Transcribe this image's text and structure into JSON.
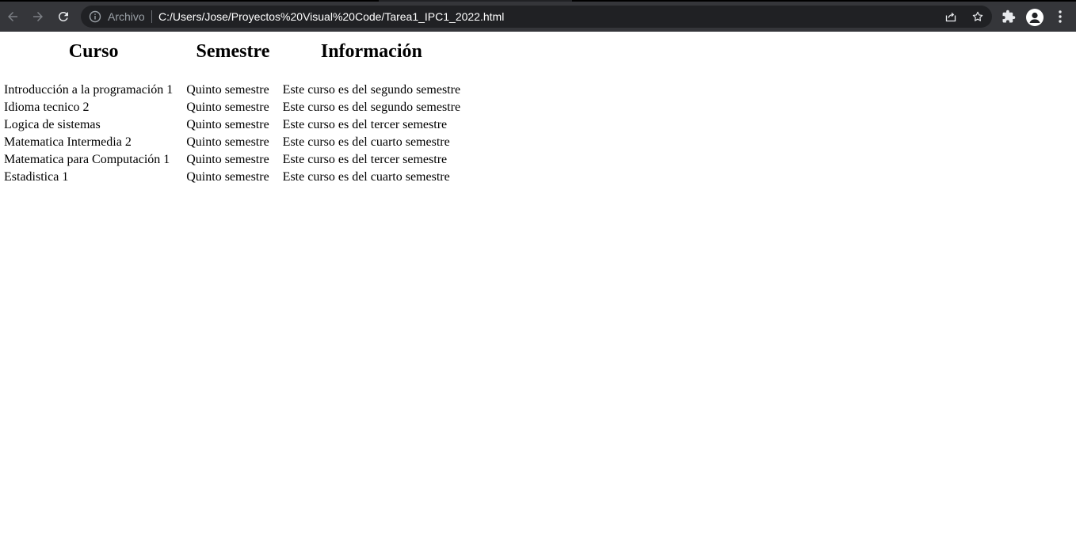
{
  "browser": {
    "scheme_label": "Archivo",
    "url": "C:/Users/Jose/Proyectos%20Visual%20Code/Tarea1_IPC1_2022.html",
    "icons": {
      "back": "arrow-left-icon",
      "forward": "arrow-right-icon",
      "reload": "reload-icon",
      "info": "info-icon",
      "share": "share-icon",
      "bookmark": "star-icon",
      "extensions": "puzzle-icon",
      "profile": "avatar-icon",
      "menu": "kebab-menu-icon"
    },
    "colors": {
      "toolbar": "#35363a",
      "omnibox": "#202124",
      "icon": "#e8eaed"
    }
  },
  "table": {
    "headers": [
      "Curso",
      "Semestre",
      "Información"
    ],
    "rows": [
      [
        "Introducción a la programación 1",
        "Quinto semestre",
        "Este curso es del segundo semestre"
      ],
      [
        "Idioma tecnico 2",
        "Quinto semestre",
        "Este curso es del segundo semestre"
      ],
      [
        "Logica de sistemas",
        "Quinto semestre",
        "Este curso es del tercer semestre"
      ],
      [
        "Matematica Intermedia 2",
        "Quinto semestre",
        "Este curso es del cuarto semestre"
      ],
      [
        "Matematica para Computación 1",
        "Quinto semestre",
        "Este curso es del tercer semestre"
      ],
      [
        "Estadistica 1",
        "Quinto semestre",
        "Este curso es del cuarto semestre"
      ]
    ]
  }
}
